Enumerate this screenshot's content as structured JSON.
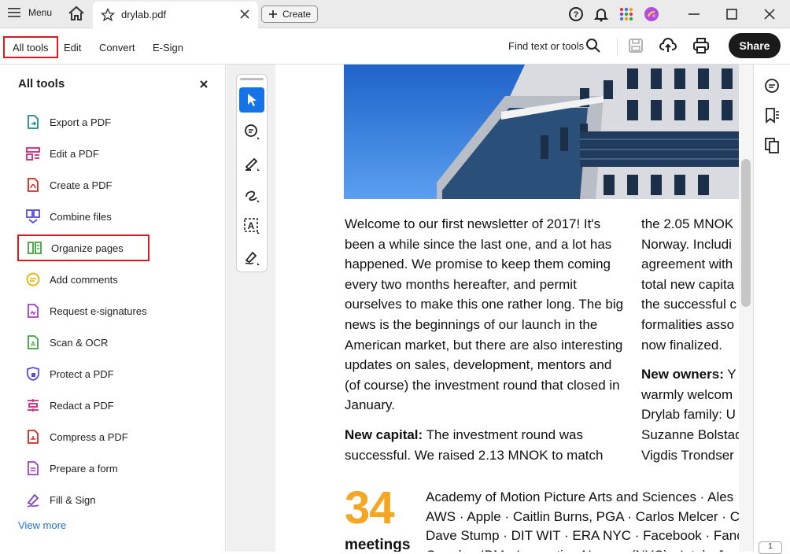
{
  "titlebar": {
    "menu_label": "Menu",
    "tab_title": "drylab.pdf",
    "create_label": "Create"
  },
  "toolbar": {
    "tabs": [
      {
        "label": "All tools",
        "active": true
      },
      {
        "label": "Edit",
        "active": false
      },
      {
        "label": "Convert",
        "active": false
      },
      {
        "label": "E-Sign",
        "active": false
      }
    ],
    "find_label": "Find text or tools",
    "share_label": "Share"
  },
  "sidebar": {
    "title": "All tools",
    "items": [
      {
        "label": "Export a PDF",
        "icon": "export-pdf-icon",
        "color": "#1b8a8a"
      },
      {
        "label": "Edit a PDF",
        "icon": "edit-pdf-icon",
        "color": "#d0257a"
      },
      {
        "label": "Create a PDF",
        "icon": "create-pdf-icon",
        "color": "#d9251d"
      },
      {
        "label": "Combine files",
        "icon": "combine-files-icon",
        "color": "#5b4bd6"
      },
      {
        "label": "Organize pages",
        "icon": "organize-pages-icon",
        "color": "#3aa53a"
      },
      {
        "label": "Add comments",
        "icon": "add-comments-icon",
        "color": "#e0b400"
      },
      {
        "label": "Request e-signatures",
        "icon": "request-esign-icon",
        "color": "#a43cc4"
      },
      {
        "label": "Scan & OCR",
        "icon": "scan-ocr-icon",
        "color": "#3aa53a"
      },
      {
        "label": "Protect a PDF",
        "icon": "protect-pdf-icon",
        "color": "#5b4bd6"
      },
      {
        "label": "Redact a PDF",
        "icon": "redact-pdf-icon",
        "color": "#d0257a"
      },
      {
        "label": "Compress a PDF",
        "icon": "compress-pdf-icon",
        "color": "#d9251d"
      },
      {
        "label": "Prepare a form",
        "icon": "prepare-form-icon",
        "color": "#a43cc4"
      },
      {
        "label": "Fill & Sign",
        "icon": "fill-sign-icon",
        "color": "#7b3cc4"
      }
    ],
    "view_more": "View more"
  },
  "document": {
    "col1_para1": "Welcome to our first newsletter of 2017! It's been a while since the last one, and a lot has happened. We promise to keep them coming every two months hereafter, and permit ourselves to make this one rather long. The big news is the beginnings of our launch in the American market, but there are also interesting updates on sales, development, mentors and (of course) the investment round that closed in January.",
    "col1_para2_bold": "New capital:",
    "col1_para2": " The investment round was successful. We raised 2.13 MNOK to match",
    "col2_lines": [
      "the 2.05 MNOK",
      "Norway. Includi",
      "agreement with",
      "total new capita",
      "the successful c",
      "formalities asso",
      "now finalized."
    ],
    "col2_para2_bold": "New owners:",
    "col2_para2_lines": [
      " Y",
      "warmly welcom",
      "Drylab family: U",
      "Suzanne Bolstad",
      "Vigdis Trondser"
    ],
    "big_number": "34",
    "meetings_label": "meetings",
    "names_lines": [
      "Academy of Motion Picture Arts and Sciences · Ales",
      "AWS · Apple · Caitlin Burns, PGA · Carlos Melcer · C",
      "Dave Stump · DIT WIT · ERA NYC · Facebook · Fancy",
      "Google · IBM · Innovation Norway (NYC) · Intel · Jo"
    ]
  },
  "page_indicator": "1",
  "colors": {
    "accent_red": "#d71920",
    "active_tool": "#1473e6",
    "share_bg": "#1a1a1a",
    "orange_number": "#f5a623",
    "link_blue": "#1e6fd9"
  }
}
